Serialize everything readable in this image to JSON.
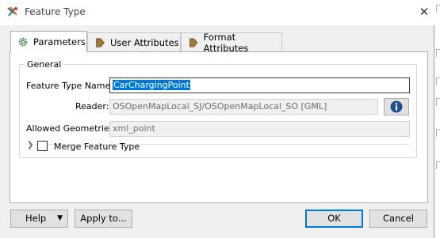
{
  "window": {
    "title": "Feature Type"
  },
  "tabs": [
    {
      "label": "Parameters",
      "icon": "gear-icon"
    },
    {
      "label": "User Attributes",
      "icon": "tag-arrow-icon"
    },
    {
      "label": "Format Attributes",
      "icon": "tag-arrow-icon"
    }
  ],
  "general": {
    "title": "General",
    "feature_type_name_label": "Feature Type Name:",
    "feature_type_name_value": "CarChargingPoint",
    "reader_label": "Reader:",
    "reader_value": "OSOpenMapLocal_SJ/OSOpenMapLocal_SO [GML]",
    "allowed_geometries_label": "Allowed Geometries:",
    "allowed_geometries_value": "xml_point",
    "merge_feature_type_label": "Merge Feature Type",
    "merge_feature_type_checked": false
  },
  "footer": {
    "help_label": "Help",
    "apply_label": "Apply to...",
    "ok_label": "OK",
    "cancel_label": "Cancel"
  },
  "colors": {
    "accent": "#0078d7",
    "tag_icon": "#a07a3a"
  }
}
